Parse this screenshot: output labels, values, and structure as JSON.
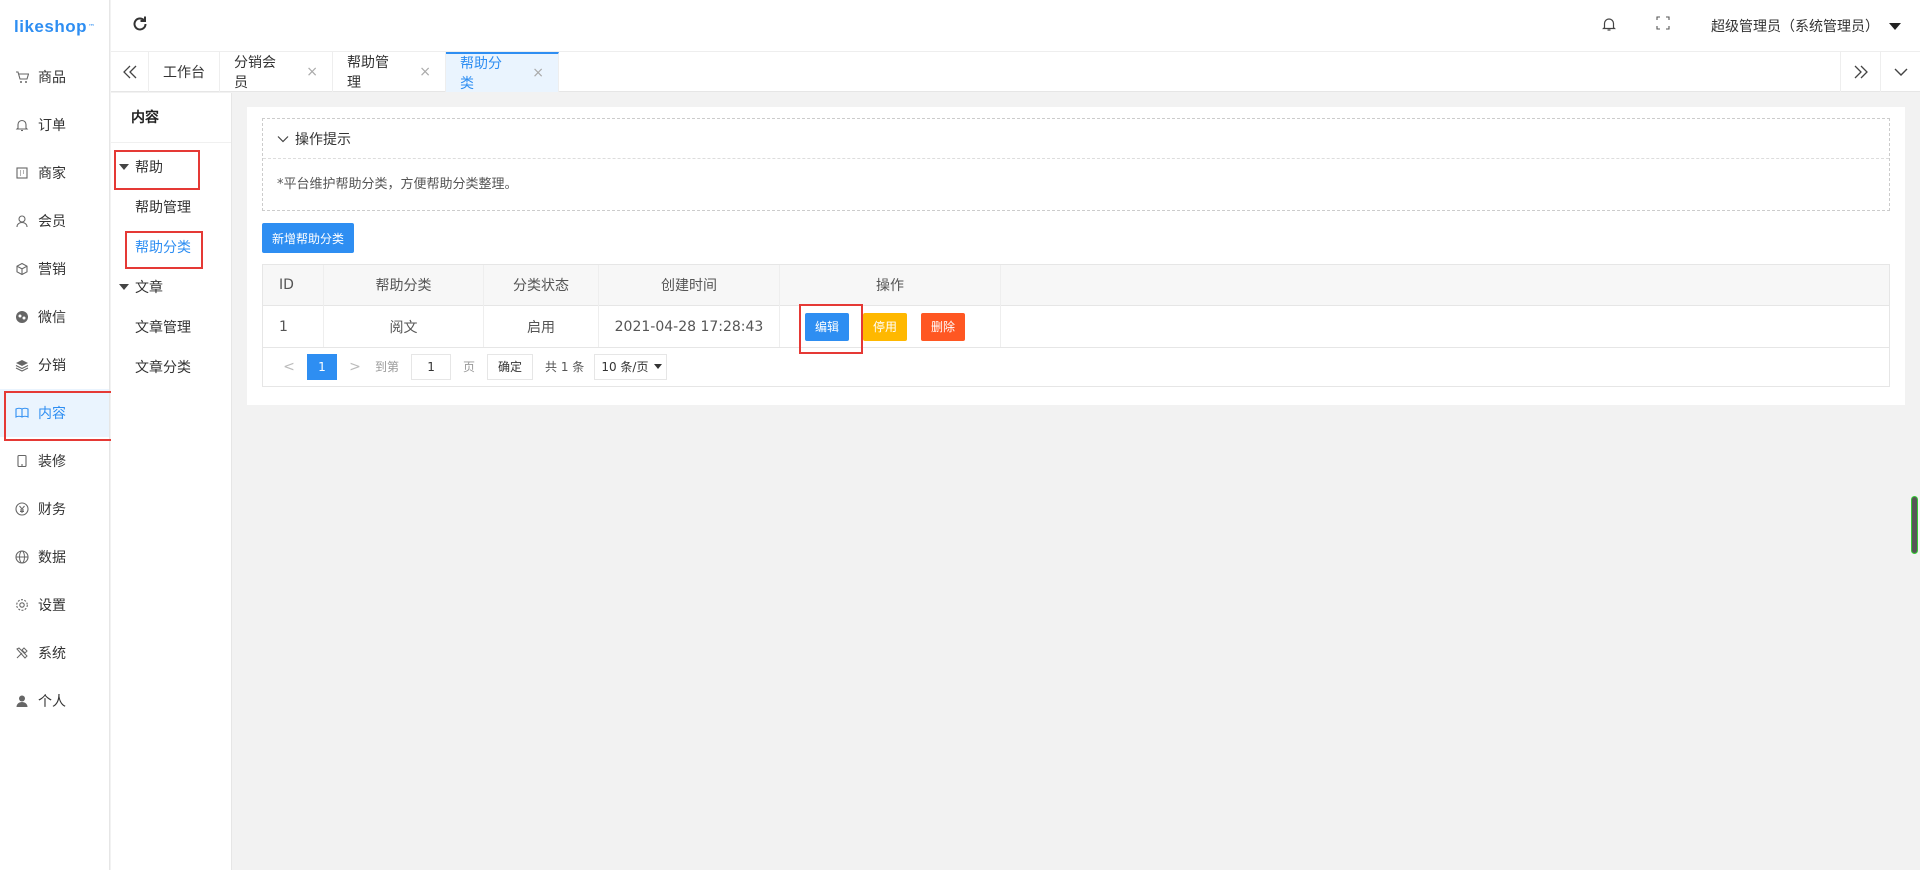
{
  "brand": {
    "logo_text": "likeshop",
    "logo_mark": "™"
  },
  "sidebar": {
    "items": [
      {
        "label": "商品",
        "icon": "cart-icon"
      },
      {
        "label": "订单",
        "icon": "bell-icon"
      },
      {
        "label": "商家",
        "icon": "store-icon"
      },
      {
        "label": "会员",
        "icon": "user-icon"
      },
      {
        "label": "营销",
        "icon": "cube-icon"
      },
      {
        "label": "微信",
        "icon": "wechat-icon"
      },
      {
        "label": "分销",
        "icon": "layers-icon"
      },
      {
        "label": "内容",
        "icon": "book-icon",
        "active": true
      },
      {
        "label": "装修",
        "icon": "tablet-icon"
      },
      {
        "label": "财务",
        "icon": "yen-icon"
      },
      {
        "label": "数据",
        "icon": "globe-icon"
      },
      {
        "label": "设置",
        "icon": "gear-icon"
      },
      {
        "label": "系统",
        "icon": "tools-icon"
      },
      {
        "label": "个人",
        "icon": "person-icon"
      }
    ]
  },
  "header": {
    "user": "超级管理员（系统管理员）"
  },
  "tabs": [
    {
      "label": "工作台",
      "closable": false
    },
    {
      "label": "分销会员",
      "closable": true
    },
    {
      "label": "帮助管理",
      "closable": true
    },
    {
      "label": "帮助分类",
      "closable": true,
      "active": true
    }
  ],
  "tab_close_glyph": "×",
  "subnav": {
    "title": "内容",
    "groups": [
      {
        "label": "帮助",
        "items": [
          "帮助管理",
          "帮助分类"
        ]
      },
      {
        "label": "文章",
        "items": [
          "文章管理",
          "文章分类"
        ]
      }
    ]
  },
  "tips": {
    "title": "操作提示",
    "text": "*平台维护帮助分类，方便帮助分类整理。"
  },
  "add_button": "新增帮助分类",
  "table": {
    "columns": [
      "ID",
      "帮助分类",
      "分类状态",
      "创建时间",
      "操作"
    ],
    "rows": [
      {
        "id": "1",
        "name": "阅文",
        "status": "启用",
        "created": "2021-04-28 17:28:43"
      }
    ],
    "actions": {
      "edit": "编辑",
      "disable": "停用",
      "delete": "删除"
    }
  },
  "pager": {
    "prev": "<",
    "next": ">",
    "current": "1",
    "goto_label": "到第",
    "goto_value": "1",
    "page_unit": "页",
    "confirm": "确定",
    "total": "共 1 条",
    "page_size": "10 条/页"
  },
  "colors": {
    "primary": "#2e8ef2",
    "warn": "#ffb800",
    "danger": "#ff5722",
    "highlight": "#e53935"
  }
}
